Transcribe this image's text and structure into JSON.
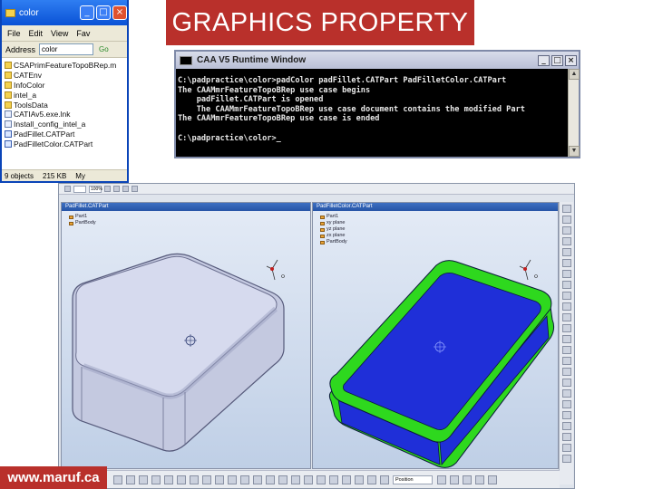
{
  "slide": {
    "title": "GRAPHICS PROPERTY",
    "footer": "www.maruf.ca"
  },
  "explorer": {
    "title": "color",
    "menu": [
      "File",
      "Edit",
      "View",
      "Fav"
    ],
    "address_label": "Address",
    "address_value": "color",
    "go_label": "Go",
    "files": [
      {
        "name": "CSAPrimFeatureTopoBRep.m",
        "kind": "folder"
      },
      {
        "name": "CATEnv",
        "kind": "folder"
      },
      {
        "name": "InfoColor",
        "kind": "folder"
      },
      {
        "name": "intel_a",
        "kind": "folder"
      },
      {
        "name": "ToolsData",
        "kind": "folder"
      },
      {
        "name": "CATIAv5.exe.lnk",
        "kind": "file"
      },
      {
        "name": "Install_config_intel_a",
        "kind": "file"
      },
      {
        "name": "PadFillet.CATPart",
        "kind": "part"
      },
      {
        "name": "PadFilletColor.CATPart",
        "kind": "part"
      }
    ],
    "status_objects": "9 objects",
    "status_size": "215 KB",
    "status_location": "My"
  },
  "console": {
    "title": "CAA V5 Runtime Window",
    "lines": [
      "C:\\padpractice\\color>padColor padFillet.CATPart PadFilletColor.CATPart",
      "The CAAMmrFeatureTopoBRep use case begins",
      "    padFillet.CATPart is opened",
      "    The CAAMmrFeatureTopoBRep use case document contains the modified Part",
      "The CAAMmrFeatureTopoBRep use case is ended",
      "",
      "C:\\padpractice\\color>_"
    ]
  },
  "catia": {
    "toolbar_zoom": "100%",
    "left_window": {
      "title": "PadFillet.CATPart",
      "tree": [
        "Part1",
        "PartBody"
      ],
      "body_color": "#cfd4ea",
      "body_edge": "#5a5f78"
    },
    "right_window": {
      "title": "PadFilletColor.CATPart",
      "tree": [
        "Part1",
        "xy plane",
        "yz plane",
        "zx plane",
        "PartBody"
      ],
      "face_color": "#1f2fd8",
      "fillet_color": "#2ed81e",
      "edge_color": "#0a1a3a"
    },
    "bottom_field": "Position"
  }
}
